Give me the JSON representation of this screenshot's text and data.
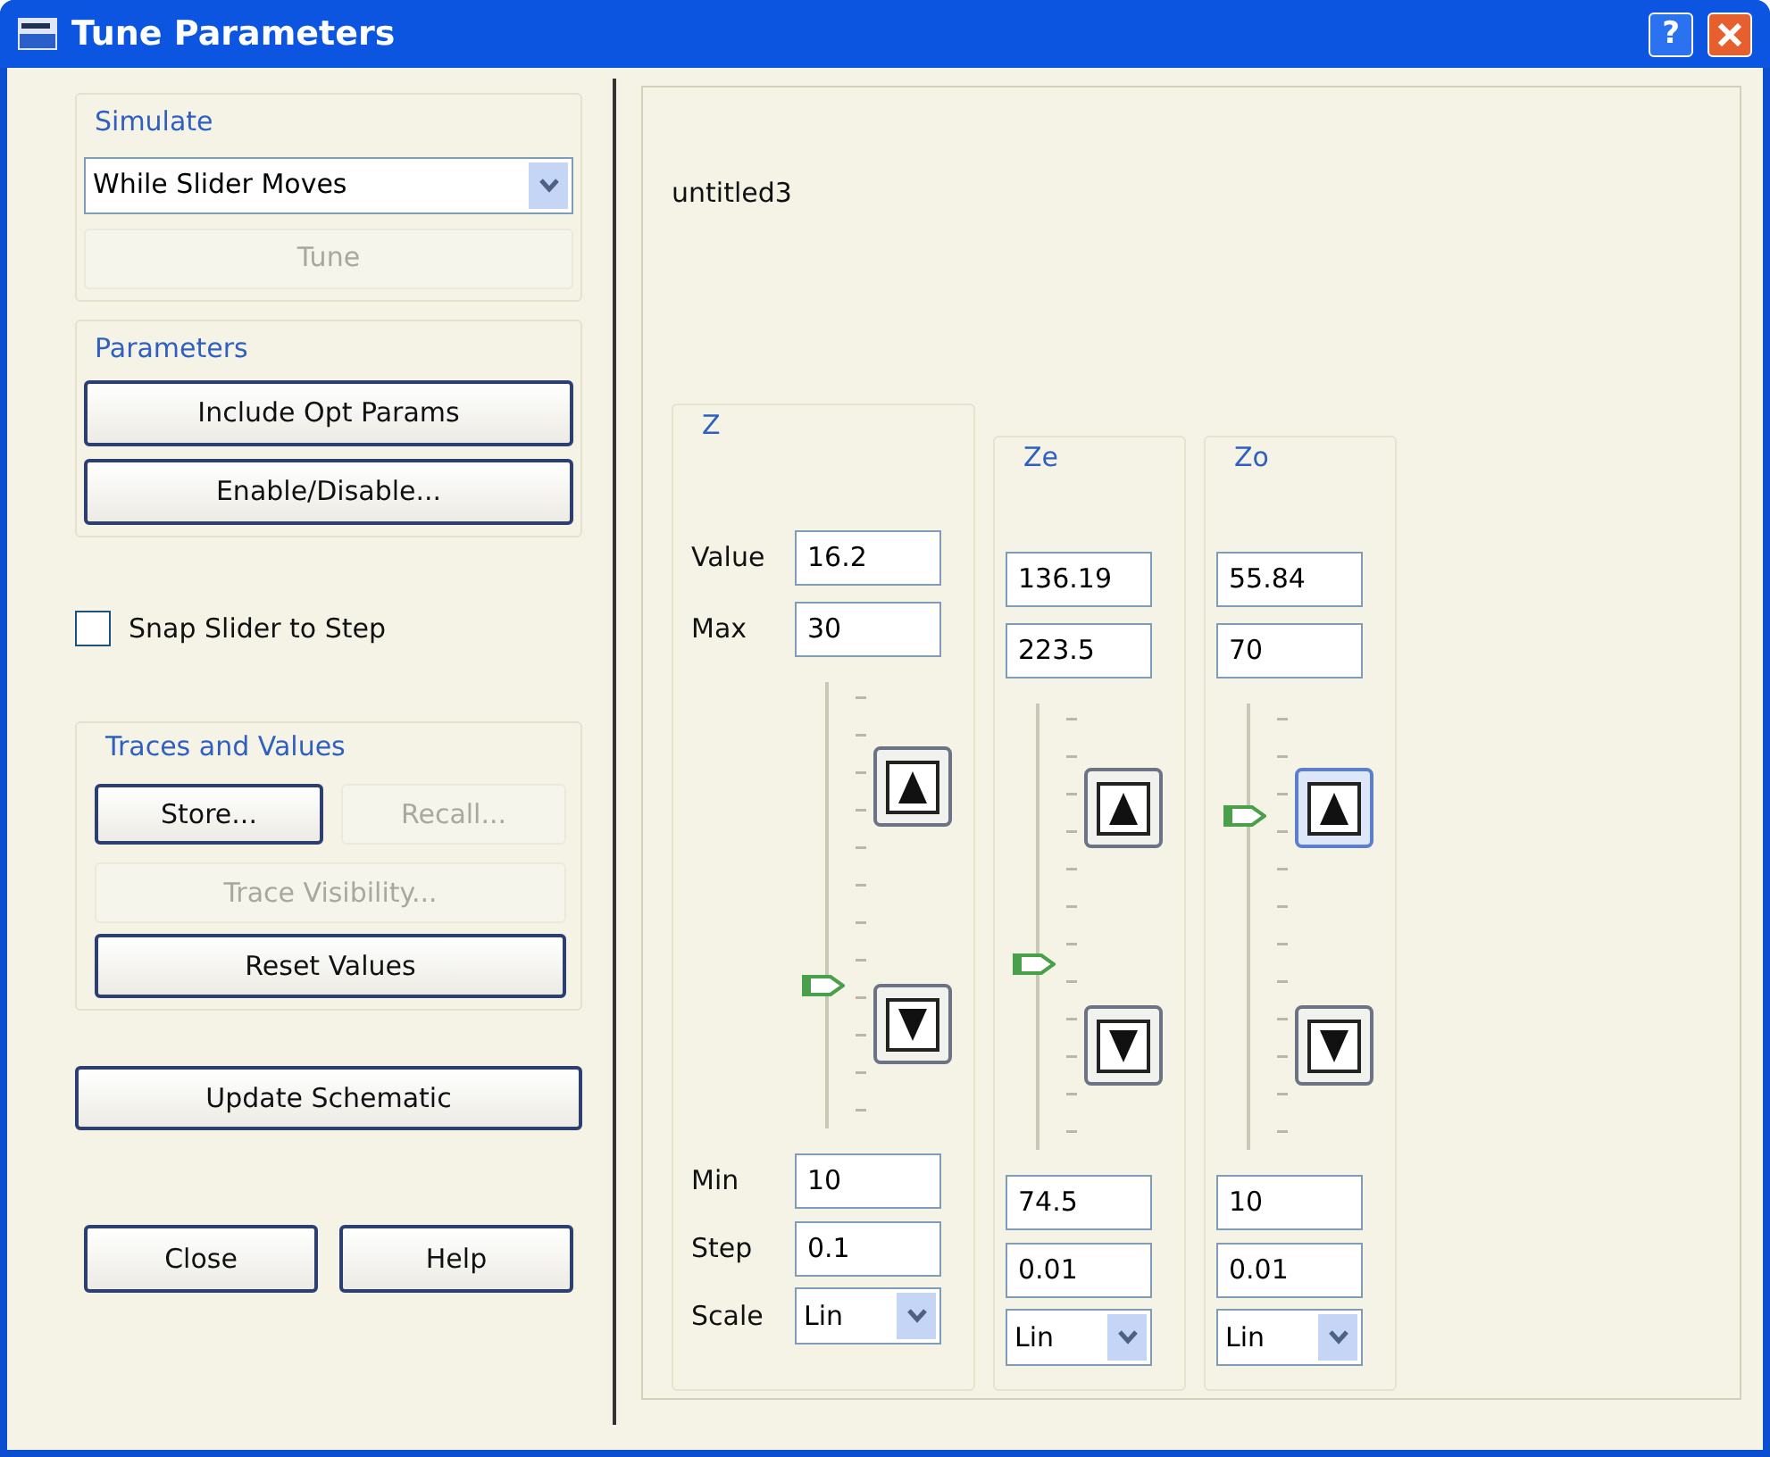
{
  "window": {
    "title": "Tune Parameters",
    "help": "?"
  },
  "simulate": {
    "title": "Simulate",
    "mode": "While Slider Moves",
    "tune": {
      "label": "Tune",
      "disabled": true
    }
  },
  "parameters": {
    "title": "Parameters",
    "buttons": [
      {
        "label": "Include Opt Params",
        "disabled": false
      },
      {
        "label": "Enable/Disable...",
        "disabled": false
      }
    ]
  },
  "snap": {
    "label": "Snap Slider to Step",
    "checked": false
  },
  "traces": {
    "title": "Traces and Values",
    "buttons": [
      {
        "label": "Store...",
        "disabled": false
      },
      {
        "label": "Recall...",
        "disabled": true
      },
      {
        "label": "Trace Visibility...",
        "disabled": true
      },
      {
        "label": "Reset Values",
        "disabled": false
      }
    ]
  },
  "update": {
    "label": "Update Schematic"
  },
  "footer_buttons": [
    "Close",
    "Help"
  ],
  "design": {
    "name": "untitled3",
    "row_labels": [
      "Value",
      "Max",
      "Min",
      "Step",
      "Scale"
    ],
    "params": [
      {
        "name": "Z",
        "value": "16.2",
        "max": "30",
        "min": "10",
        "step": "0.1",
        "scale": "Lin",
        "level": 0.31,
        "focused": false
      },
      {
        "name": "Ze",
        "value": "136.19",
        "max": "223.5",
        "min": "74.5",
        "step": "0.01",
        "scale": "Lin",
        "level": 0.41,
        "focused": false
      },
      {
        "name": "Zo",
        "value": "55.84",
        "max": "70",
        "min": "10",
        "step": "0.01",
        "scale": "Lin",
        "level": 0.76,
        "focused": true
      }
    ]
  }
}
